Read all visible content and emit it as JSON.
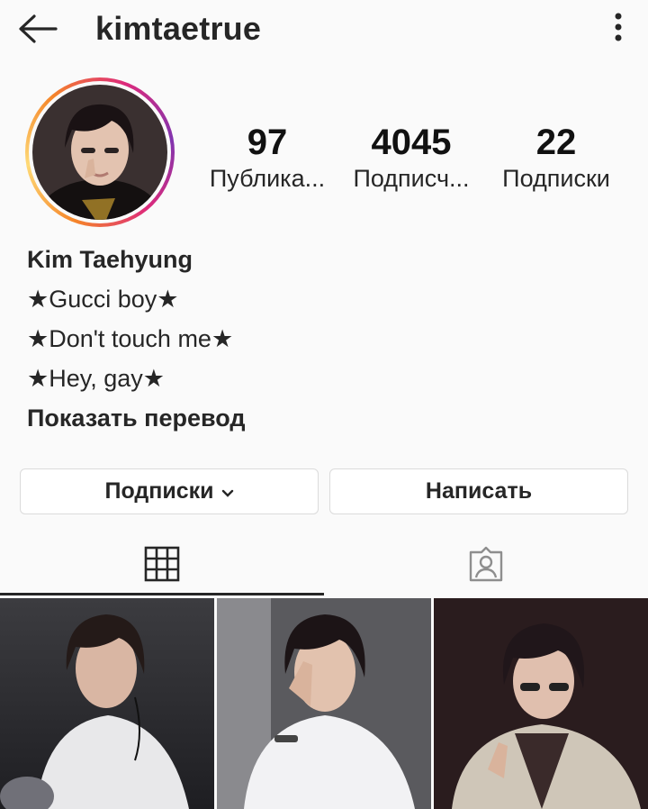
{
  "header": {
    "username": "kimtaetrue",
    "back_icon": "arrow-left-icon",
    "more_icon": "vertical-dots-icon"
  },
  "profile": {
    "avatar_ring_colors": [
      "#f58529",
      "#feda77",
      "#dd2a7b",
      "#8134af"
    ],
    "stats": [
      {
        "value": "97",
        "label": "Публика..."
      },
      {
        "value": "4045",
        "label": "Подписч..."
      },
      {
        "value": "22",
        "label": "Подписки"
      }
    ]
  },
  "bio": {
    "name": "Kim Taehyung",
    "lines": [
      "★Gucci boy★",
      "★Don't touch me★",
      "★Hey, gay★"
    ],
    "translate": "Показать перевод"
  },
  "actions": {
    "following_label": "Подписки",
    "message_label": "Написать"
  },
  "tabs": [
    {
      "icon": "grid-icon",
      "active": true
    },
    {
      "icon": "tagged-person-icon",
      "active": false
    }
  ]
}
